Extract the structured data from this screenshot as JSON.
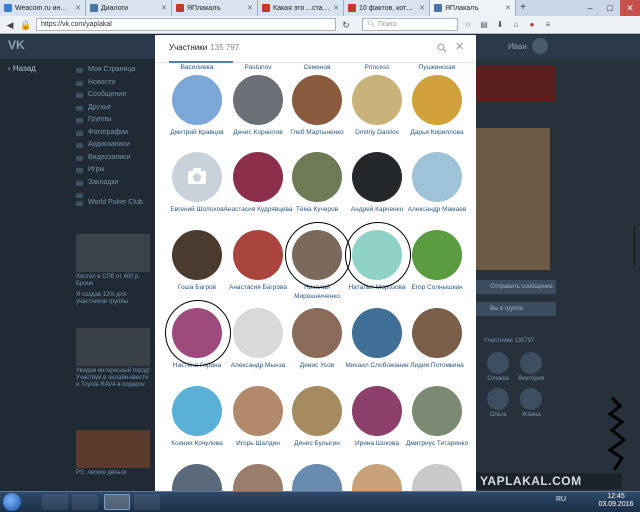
{
  "browser": {
    "tabs": [
      {
        "title": "Weacom.ru информ...",
        "active": false,
        "favicon_color": "#3b7bd6"
      },
      {
        "title": "Диалоги",
        "active": false,
        "favicon_color": "#4a76a8"
      },
      {
        "title": "ЯПлакалъ",
        "active": false,
        "favicon_color": "#c0392b"
      },
      {
        "title": "Какая это ...ста? Это ...",
        "active": false,
        "favicon_color": "#c0392b"
      },
      {
        "title": "10 фактов, которые ...",
        "active": false,
        "favicon_color": "#c0392b"
      },
      {
        "title": "ЯПлакалъ",
        "active": true,
        "favicon_color": "#4a76a8"
      }
    ],
    "new_tab": "+",
    "controls": {
      "minimize": "–",
      "maximize": "□",
      "close": "✕"
    },
    "url": "https://vk.com/yaplakal",
    "search_placeholder": "Поиск"
  },
  "vk": {
    "logo": "VK",
    "user_name": "Иван",
    "newsfeed_label": "Назад",
    "menu": [
      "Моя Страница",
      "Новости",
      "Сообщения",
      "Друзья",
      "Группы",
      "Фотографии",
      "Аудиозаписи",
      "Видеозаписи",
      "Игры",
      "Закладки",
      "",
      "World Poker Club"
    ],
    "ads": [
      {
        "text": "Хостел в СПб от 400 р. Брони"
      },
      {
        "text": "Я создав 12% для участников группы"
      },
      {
        "text": "Увидев интересный город! Участвуй в онлайн-квесте и Toyota RAV4 в подарок"
      },
      {
        "text": "PS: легкие деньги"
      }
    ],
    "right": {
      "send_message": "Отправить сообщение",
      "in_group": "Вы в группе",
      "members_count": "Участники 135797",
      "people": [
        "Олежка",
        "Виктория",
        "Ольга",
        "Жанна"
      ]
    },
    "watermark": "YAPLAKAL.COM"
  },
  "modal": {
    "title": "Участники",
    "count": "135 797",
    "top_row": [
      "Василиева",
      "Pastunov",
      "Семенов",
      "Princess",
      "Пушкинская"
    ],
    "members": [
      {
        "name": "Дмитрий Кравцов",
        "color": "#7aa7d6"
      },
      {
        "name": "Денис Корнилов",
        "color": "#6b6f76"
      },
      {
        "name": "Глеб Мартыненко",
        "color": "#8a5a3f"
      },
      {
        "name": "Dmitriy Danilov",
        "color": "#c9b27a"
      },
      {
        "name": "Дарья Кириллова",
        "color": "#d1a13b"
      },
      {
        "name": "Евгений Шолохов",
        "color": "#c9d1da",
        "placeholder": true
      },
      {
        "name": "Анастасия Кудрявцева",
        "color": "#8b2f4b"
      },
      {
        "name": "Тёма Кучеров",
        "color": "#6e7a55"
      },
      {
        "name": "Андрей Карченко",
        "color": "#25282b"
      },
      {
        "name": "Александр Мамаев",
        "color": "#9ec2d8"
      },
      {
        "name": "Гоша Багров",
        "color": "#4a3b2e"
      },
      {
        "name": "Анастасия Багрова",
        "color": "#a9453e"
      },
      {
        "name": "Николай Мирошниченко",
        "color": "#7b6a5c"
      },
      {
        "name": "Наталья Морозова",
        "color": "#8fd3c8"
      },
      {
        "name": "Егор Солнышкин",
        "color": "#5a9c3f"
      },
      {
        "name": "Настёна Горина",
        "color": "#9d4b7d"
      },
      {
        "name": "Александр Мынза",
        "color": "#d9d9d9"
      },
      {
        "name": "Денис Усов",
        "color": "#8a6a58"
      },
      {
        "name": "Михаил Слобожанин",
        "color": "#3f6f94"
      },
      {
        "name": "Лидия Потомкина",
        "color": "#7a5e4a"
      },
      {
        "name": "Ксения Кочулова",
        "color": "#5bb0d8"
      },
      {
        "name": "Игорь Шалдин",
        "color": "#b08a6a"
      },
      {
        "name": "Денис Булыгин",
        "color": "#a78b60"
      },
      {
        "name": "Ирина Шокова",
        "color": "#8c3f6a"
      },
      {
        "name": "Дмитриус Титаренко",
        "color": "#7b8a73"
      },
      {
        "name": "",
        "color": "#5a6a7a"
      },
      {
        "name": "",
        "color": "#9a7d6a"
      },
      {
        "name": "",
        "color": "#6a8bb0"
      },
      {
        "name": "",
        "color": "#c7a27a"
      },
      {
        "name": "",
        "color": "#c9c9c9"
      }
    ],
    "circled": [
      12,
      13,
      15
    ]
  },
  "taskbar": {
    "apps": [
      "explorer",
      "media",
      "firefox",
      "vs"
    ],
    "active_app": "firefox",
    "lang": "RU",
    "time": "12:45",
    "date": "03.09.2016"
  }
}
